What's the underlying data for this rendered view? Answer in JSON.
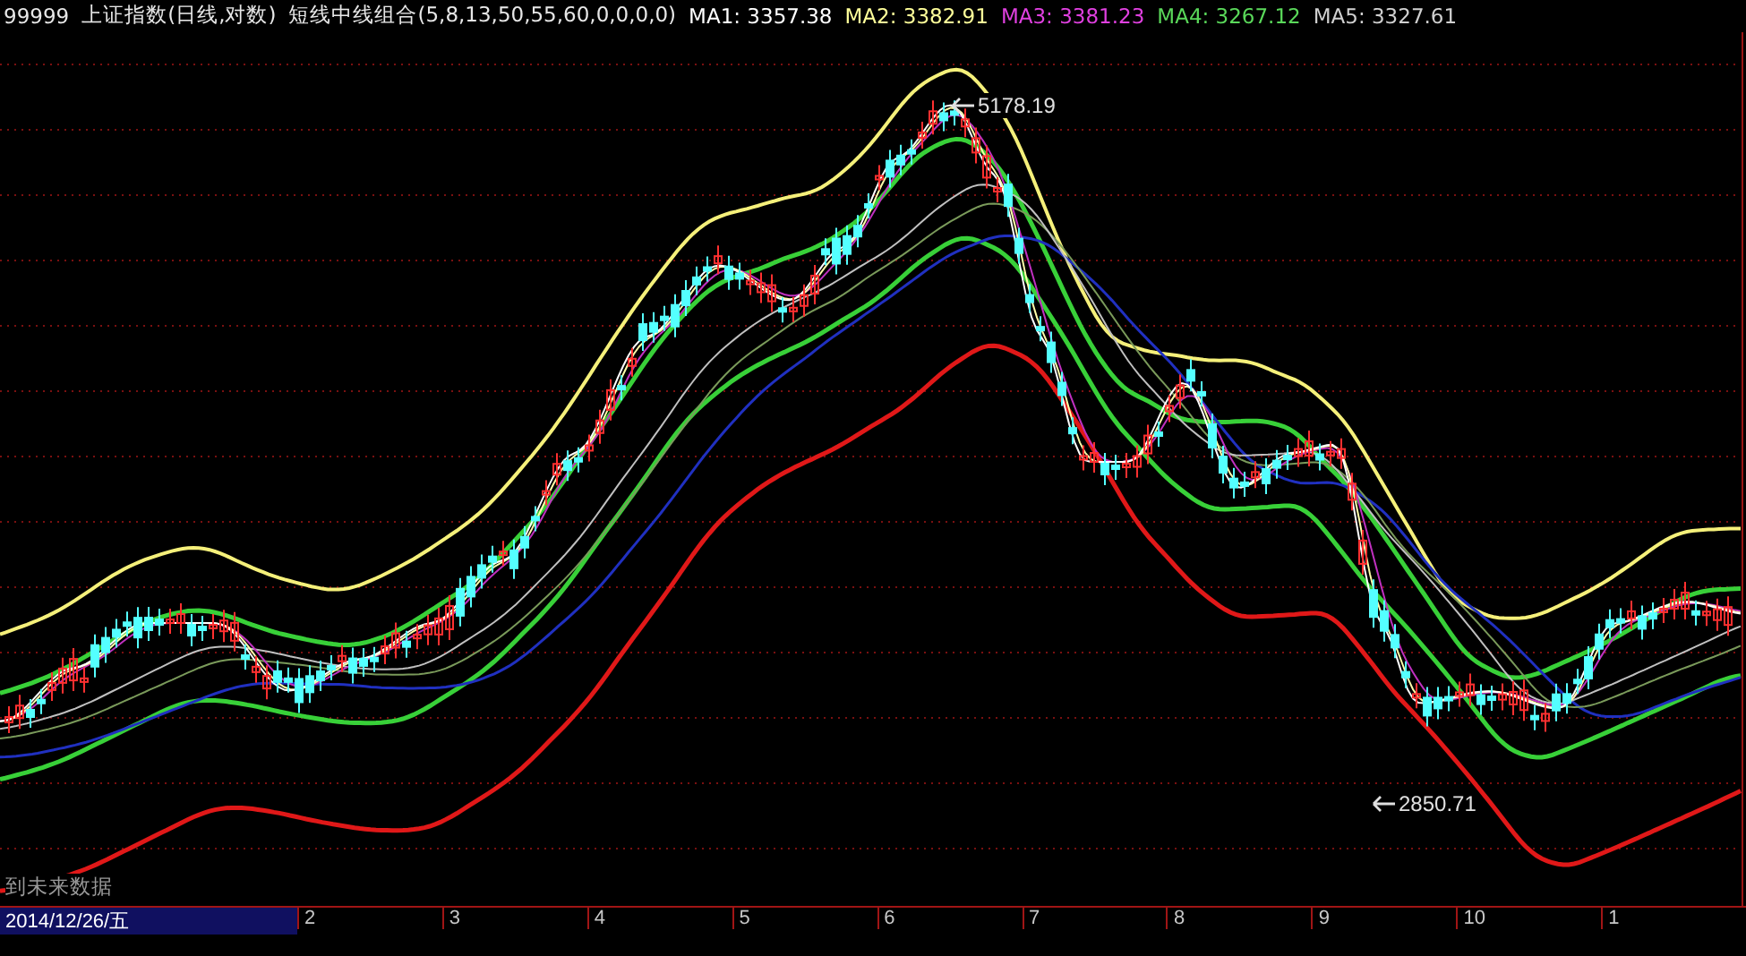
{
  "header": {
    "code": "99999",
    "name": "上证指数(日线,对数)",
    "formula": "短线中线组合(5,8,13,50,55,60,0,0,0,0)",
    "ma": [
      {
        "label": "MA1:",
        "value": "3357.38",
        "color": "#ffffff"
      },
      {
        "label": "MA2:",
        "value": "3382.91",
        "color": "#ffff9a"
      },
      {
        "label": "MA3:",
        "value": "3381.23",
        "color": "#e040e0"
      },
      {
        "label": "MA4:",
        "value": "3267.12",
        "color": "#5ad85a"
      },
      {
        "label": "MA5:",
        "value": "3327.61",
        "color": "#d0d0d0"
      }
    ]
  },
  "price_labels": [
    {
      "kind": "high",
      "text": "5178.19"
    },
    {
      "kind": "low",
      "text": "2850.71"
    }
  ],
  "note": "到未来数据",
  "axis": {
    "date": "2014/12/26/五",
    "ticks": [
      "2",
      "3",
      "4",
      "5",
      "6",
      "7",
      "8",
      "9",
      "10",
      "1"
    ]
  }
}
